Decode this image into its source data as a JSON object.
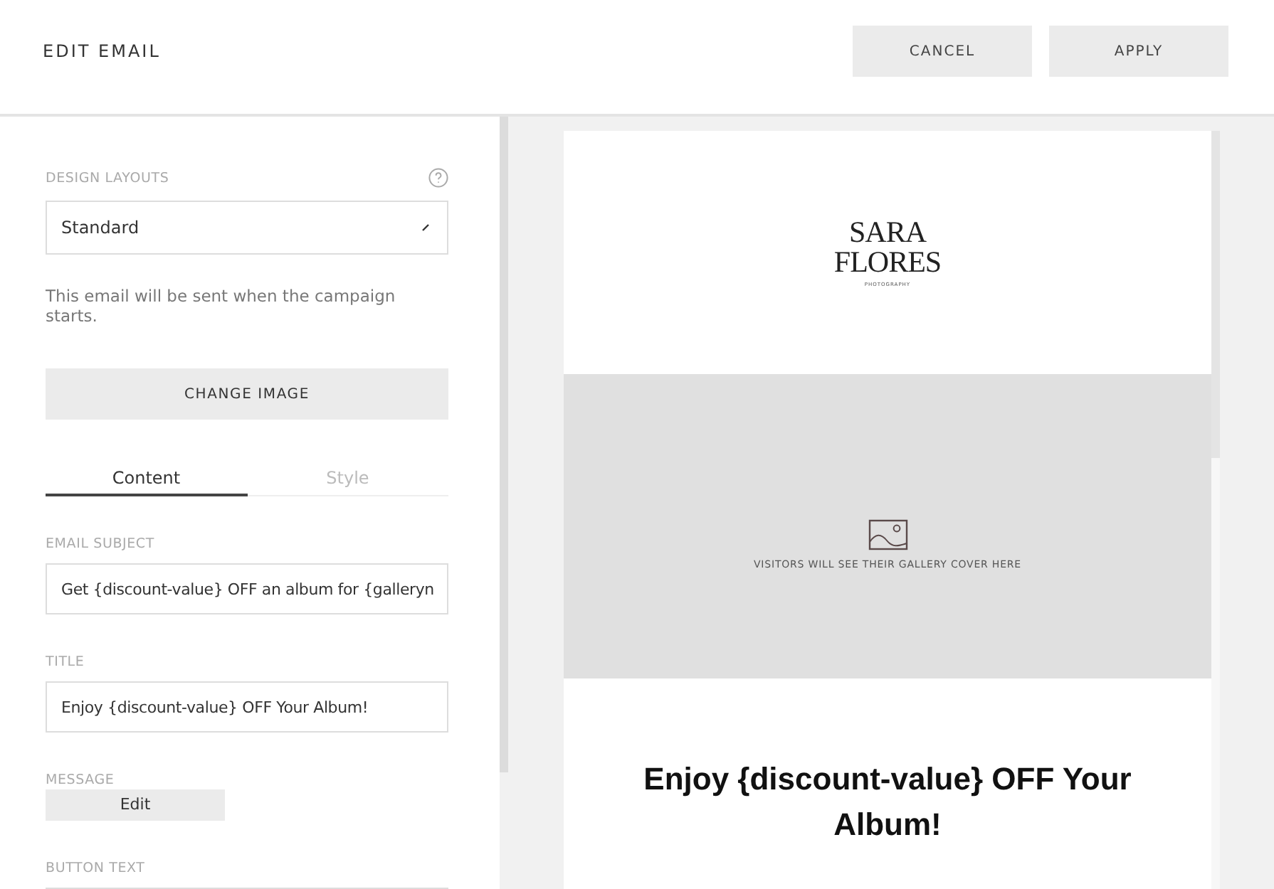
{
  "header": {
    "title": "EDIT EMAIL",
    "buttons": [
      "CANCEL",
      "APPLY"
    ]
  },
  "panel": {
    "layout_label": "DESIGN LAYOUTS",
    "layout_value": "Standard",
    "note": "This email will be sent when the campaign starts.",
    "change_image": "CHANGE IMAGE",
    "tabs": [
      {
        "label": "Content",
        "selected": true
      },
      {
        "label": "Style",
        "selected": false
      }
    ],
    "subject_label": "EMAIL SUBJECT",
    "subject_value": "Get {discount-value} OFF an album for {galleryn",
    "title_label": "TITLE",
    "title_value": "Enjoy {discount-value} OFF Your Album!",
    "message_label": "MESSAGE",
    "message_button": "Edit",
    "button_text_label": "BUTTON TEXT"
  },
  "preview": {
    "logo_lines": [
      "SARA",
      "FLORES"
    ],
    "logo_tagline": "PHOTOGRAPHY",
    "cover_note": "VISITORS WILL SEE THEIR GALLERY COVER HERE",
    "title": "Enjoy {discount-value} OFF Your Album!"
  }
}
